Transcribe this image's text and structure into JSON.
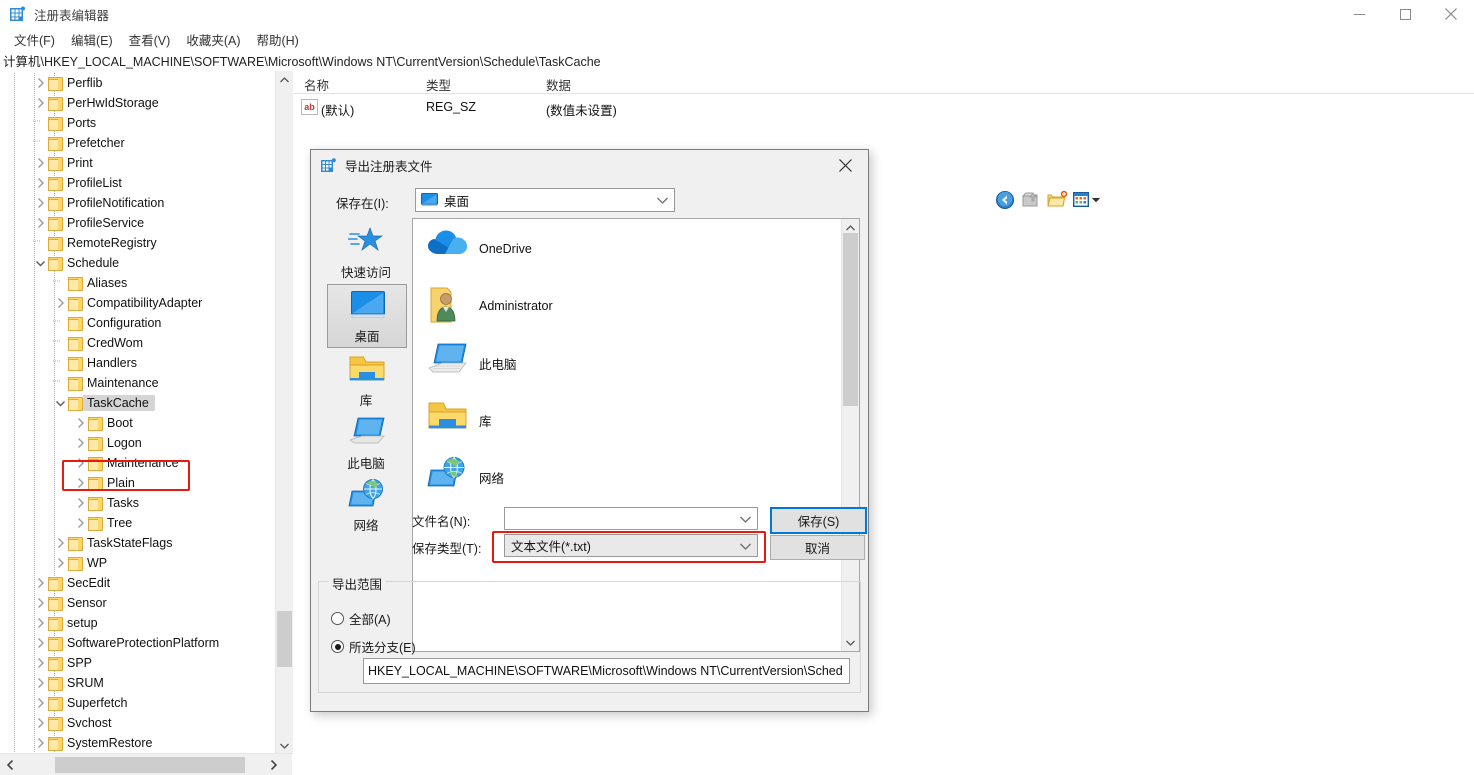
{
  "window": {
    "title": "注册表编辑器",
    "icon": "registry-editor-icon",
    "minimize_label": "—",
    "maximize_label": "□",
    "close_label": "✕"
  },
  "menubar": {
    "items": [
      {
        "label": "文件(F)",
        "name": "menu-file"
      },
      {
        "label": "编辑(E)",
        "name": "menu-edit"
      },
      {
        "label": "查看(V)",
        "name": "menu-view"
      },
      {
        "label": "收藏夹(A)",
        "name": "menu-favorites"
      },
      {
        "label": "帮助(H)",
        "name": "menu-help"
      }
    ]
  },
  "address": {
    "path": "计算机\\HKEY_LOCAL_MACHINE\\SOFTWARE\\Microsoft\\Windows NT\\CurrentVersion\\Schedule\\TaskCache"
  },
  "tree": {
    "selected": "TaskCache",
    "items": [
      {
        "label": "Perflib",
        "depth": 2,
        "expandable": true,
        "expanded": false
      },
      {
        "label": "PerHwIdStorage",
        "depth": 2,
        "expandable": true,
        "expanded": false
      },
      {
        "label": "Ports",
        "depth": 2,
        "expandable": false,
        "expanded": false
      },
      {
        "label": "Prefetcher",
        "depth": 2,
        "expandable": false,
        "expanded": false
      },
      {
        "label": "Print",
        "depth": 2,
        "expandable": true,
        "expanded": false
      },
      {
        "label": "ProfileList",
        "depth": 2,
        "expandable": true,
        "expanded": false
      },
      {
        "label": "ProfileNotification",
        "depth": 2,
        "expandable": true,
        "expanded": false
      },
      {
        "label": "ProfileService",
        "depth": 2,
        "expandable": true,
        "expanded": false
      },
      {
        "label": "RemoteRegistry",
        "depth": 2,
        "expandable": false,
        "expanded": false
      },
      {
        "label": "Schedule",
        "depth": 2,
        "expandable": true,
        "expanded": true
      },
      {
        "label": "Aliases",
        "depth": 3,
        "expandable": false,
        "expanded": false
      },
      {
        "label": "CompatibilityAdapter",
        "depth": 3,
        "expandable": true,
        "expanded": false
      },
      {
        "label": "Configuration",
        "depth": 3,
        "expandable": false,
        "expanded": false
      },
      {
        "label": "CredWom",
        "depth": 3,
        "expandable": false,
        "expanded": false
      },
      {
        "label": "Handlers",
        "depth": 3,
        "expandable": false,
        "expanded": false
      },
      {
        "label": "Maintenance",
        "depth": 3,
        "expandable": false,
        "expanded": false
      },
      {
        "label": "TaskCache",
        "depth": 3,
        "expandable": true,
        "expanded": true,
        "selected": true
      },
      {
        "label": "Boot",
        "depth": 4,
        "expandable": true,
        "expanded": false
      },
      {
        "label": "Logon",
        "depth": 4,
        "expandable": true,
        "expanded": false
      },
      {
        "label": "Maintenance",
        "depth": 4,
        "expandable": true,
        "expanded": false
      },
      {
        "label": "Plain",
        "depth": 4,
        "expandable": true,
        "expanded": false
      },
      {
        "label": "Tasks",
        "depth": 4,
        "expandable": true,
        "expanded": false
      },
      {
        "label": "Tree",
        "depth": 4,
        "expandable": true,
        "expanded": false
      },
      {
        "label": "TaskStateFlags",
        "depth": 3,
        "expandable": true,
        "expanded": false
      },
      {
        "label": "WP",
        "depth": 3,
        "expandable": true,
        "expanded": false
      },
      {
        "label": "SecEdit",
        "depth": 2,
        "expandable": true,
        "expanded": false
      },
      {
        "label": "Sensor",
        "depth": 2,
        "expandable": true,
        "expanded": false
      },
      {
        "label": "setup",
        "depth": 2,
        "expandable": true,
        "expanded": false
      },
      {
        "label": "SoftwareProtectionPlatform",
        "depth": 2,
        "expandable": true,
        "expanded": false
      },
      {
        "label": "SPP",
        "depth": 2,
        "expandable": true,
        "expanded": false
      },
      {
        "label": "SRUM",
        "depth": 2,
        "expandable": true,
        "expanded": false
      },
      {
        "label": "Superfetch",
        "depth": 2,
        "expandable": true,
        "expanded": false
      },
      {
        "label": "Svchost",
        "depth": 2,
        "expandable": true,
        "expanded": false
      },
      {
        "label": "SystemRestore",
        "depth": 2,
        "expandable": true,
        "expanded": false
      }
    ]
  },
  "values": {
    "columns": [
      "名称",
      "类型",
      "数据"
    ],
    "rows": [
      {
        "name": "(默认)",
        "type": "REG_SZ",
        "data": "(数值未设置)",
        "icon": "ab-string-icon"
      }
    ]
  },
  "dialog": {
    "title": "导出注册表文件",
    "icon": "registry-file-icon",
    "close_label": "✕",
    "savein": {
      "label": "保存在(I):",
      "value": "桌面",
      "icon": "desktop-monitor-icon"
    },
    "toolbar": [
      {
        "name": "back-icon",
        "label": "后退"
      },
      {
        "name": "up-folder-icon",
        "label": "向上一级"
      },
      {
        "name": "new-folder-icon",
        "label": "新建文件夹"
      },
      {
        "name": "views-icon",
        "label": "视图"
      }
    ],
    "places": [
      {
        "label": "快速访问",
        "icon": "quick-access-star-icon",
        "selected": false
      },
      {
        "label": "桌面",
        "icon": "desktop-monitor-icon",
        "selected": true
      },
      {
        "label": "库",
        "icon": "library-folder-icon",
        "selected": false
      },
      {
        "label": "此电脑",
        "icon": "this-pc-icon",
        "selected": false
      },
      {
        "label": "网络",
        "icon": "network-globe-icon",
        "selected": false
      }
    ],
    "files": [
      {
        "label": "OneDrive",
        "icon": "onedrive-cloud-icon"
      },
      {
        "label": "Administrator",
        "icon": "user-folder-icon"
      },
      {
        "label": "此电脑",
        "icon": "this-pc-icon"
      },
      {
        "label": "库",
        "icon": "library-folder-icon"
      },
      {
        "label": "网络",
        "icon": "network-globe-icon"
      }
    ],
    "filename": {
      "label": "文件名(N):",
      "value": "",
      "placeholder": ""
    },
    "filetype": {
      "label": "保存类型(T):",
      "value": "文本文件(*.txt)",
      "highlighted": true
    },
    "buttons": {
      "save": "保存(S)",
      "cancel": "取消"
    },
    "export_range": {
      "title": "导出范围",
      "options": [
        {
          "label": "全部(A)",
          "selected": false
        },
        {
          "label": "所选分支(E)",
          "selected": true
        }
      ],
      "branch_path": "HKEY_LOCAL_MACHINE\\SOFTWARE\\Microsoft\\Windows NT\\CurrentVersion\\Sched"
    }
  },
  "colors": {
    "highlight_red": "#e8190d",
    "accent_blue": "#0078d7",
    "folder_yellow": "#fcd667",
    "dialog_bg": "#f0f0f0"
  }
}
